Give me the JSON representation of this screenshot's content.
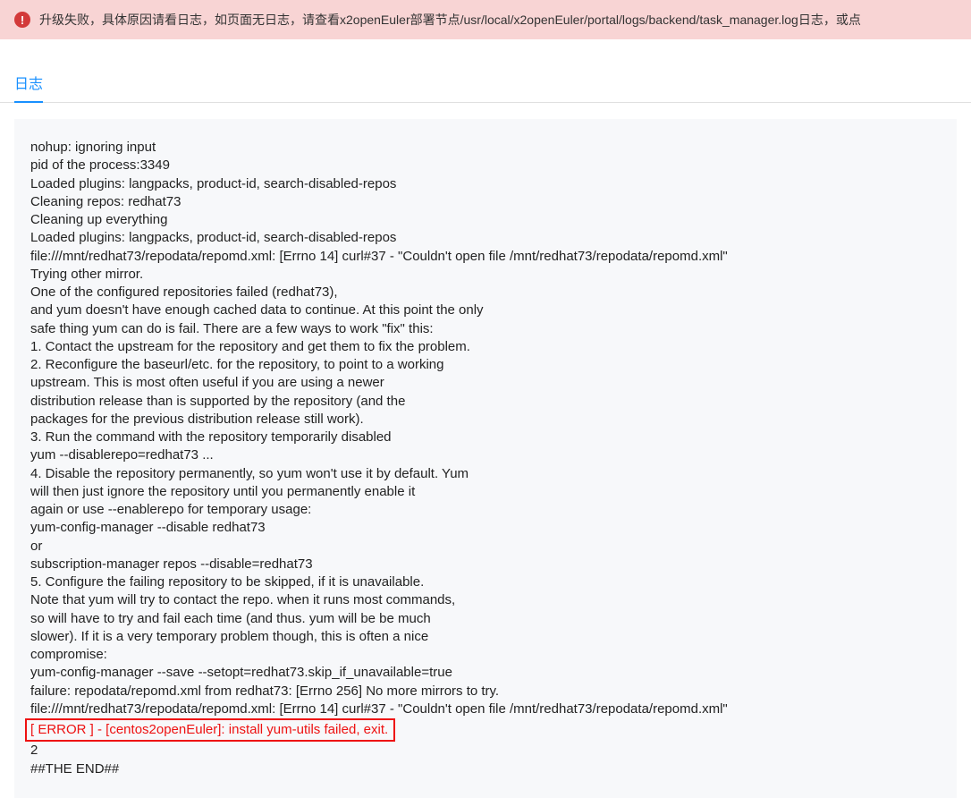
{
  "alert": {
    "message": "升级失败，具体原因请看日志，如页面无日志，请查看x2openEuler部署节点/usr/local/x2openEuler/portal/logs/backend/task_manager.log日志，或点"
  },
  "tabs": {
    "log": "日志"
  },
  "log": {
    "lines": [
      "nohup: ignoring input",
      "pid of the process:3349",
      "Loaded plugins: langpacks, product-id, search-disabled-repos",
      "Cleaning repos: redhat73",
      "Cleaning up everything",
      "Loaded plugins: langpacks, product-id, search-disabled-repos",
      "file:///mnt/redhat73/repodata/repomd.xml: [Errno 14] curl#37 - \"Couldn't open file /mnt/redhat73/repodata/repomd.xml\"",
      "Trying other mirror.",
      "One of the configured repositories failed (redhat73),",
      "and yum doesn't have enough cached data to continue. At this point the only",
      "safe thing yum can do is fail. There are a few ways to work \"fix\" this:",
      "1. Contact the upstream for the repository and get them to fix the problem.",
      "2. Reconfigure the baseurl/etc. for the repository, to point to a working",
      "upstream. This is most often useful if you are using a newer",
      "distribution release than is supported by the repository (and the",
      "packages for the previous distribution release still work).",
      "3. Run the command with the repository temporarily disabled",
      "yum --disablerepo=redhat73 ...",
      "4. Disable the repository permanently, so yum won't use it by default. Yum",
      "will then just ignore the repository until you permanently enable it",
      "again or use --enablerepo for temporary usage:",
      "yum-config-manager --disable redhat73",
      "or",
      "subscription-manager repos --disable=redhat73",
      "5. Configure the failing repository to be skipped, if it is unavailable.",
      "Note that yum will try to contact the repo. when it runs most commands,",
      "so will have to try and fail each time (and thus. yum will be be much",
      "slower). If it is a very temporary problem though, this is often a nice",
      "compromise:",
      "yum-config-manager --save --setopt=redhat73.skip_if_unavailable=true",
      "failure: repodata/repomd.xml from redhat73: [Errno 256] No more mirrors to try.",
      "file:///mnt/redhat73/repodata/repomd.xml: [Errno 14] curl#37 - \"Couldn't open file /mnt/redhat73/repodata/repomd.xml\""
    ],
    "error_line": "[ ERROR ] - [centos2openEuler]: install yum-utils failed, exit.",
    "after_error": [
      "2",
      "##THE END##"
    ]
  }
}
